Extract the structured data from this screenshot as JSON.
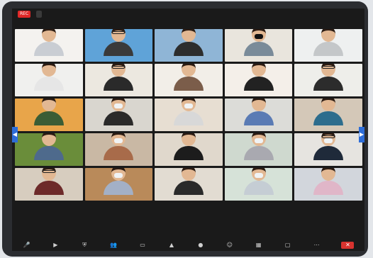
{
  "topbar": {
    "rec_label": "REC",
    "meeting_id": ""
  },
  "accent_colors": {
    "rec": "#e02828",
    "nav_arrow": "#2d6dd8",
    "end_button": "#d8332f"
  },
  "nav": {
    "prev_icon": "chevron-left-icon",
    "next_icon": "chevron-right-icon"
  },
  "tiles": [
    {
      "name": "",
      "bg": "#f4f2ef",
      "shirt": "#c9cdd3",
      "mask": "",
      "glasses": false
    },
    {
      "name": "",
      "bg": "#5fa3d8",
      "shirt": "#3a3a3a",
      "mask": "",
      "glasses": true
    },
    {
      "name": "",
      "bg": "#8fb5d6",
      "shirt": "#2d2d2d",
      "mask": "",
      "glasses": false
    },
    {
      "name": "",
      "bg": "#e9e5dd",
      "shirt": "#7a8b99",
      "mask": "black",
      "glasses": false
    },
    {
      "name": "",
      "bg": "#eef0f0",
      "shirt": "#c4c7c9",
      "mask": "",
      "glasses": false
    },
    {
      "name": "",
      "bg": "#f0f0ee",
      "shirt": "#e6e6e6",
      "mask": "",
      "glasses": false
    },
    {
      "name": "",
      "bg": "#ece8e0",
      "shirt": "#2a2a2a",
      "mask": "",
      "glasses": true
    },
    {
      "name": "",
      "bg": "#f2eee8",
      "shirt": "#7b5d4a",
      "mask": "",
      "glasses": false
    },
    {
      "name": "",
      "bg": "#f4efe9",
      "shirt": "#222222",
      "mask": "",
      "glasses": false
    },
    {
      "name": "",
      "bg": "#eeeeea",
      "shirt": "#2c2c2c",
      "mask": "",
      "glasses": true
    },
    {
      "name": "",
      "bg": "#e8a54a",
      "shirt": "#3b5d35",
      "mask": "",
      "glasses": false
    },
    {
      "name": "",
      "bg": "#d9d6cf",
      "shirt": "#2a2a2a",
      "mask": "white",
      "glasses": false
    },
    {
      "name": "",
      "bg": "#e7ded2",
      "shirt": "#d8d8d8",
      "mask": "white",
      "glasses": false
    },
    {
      "name": "",
      "bg": "#dcdcd8",
      "shirt": "#5a7bb4",
      "mask": "",
      "glasses": false
    },
    {
      "name": "",
      "bg": "#d4c8b8",
      "shirt": "#2d6d8d",
      "mask": "",
      "glasses": false
    },
    {
      "name": "",
      "bg": "#6a8d3a",
      "shirt": "#4e6a8c",
      "mask": "",
      "glasses": false
    },
    {
      "name": "",
      "bg": "#c9b8a4",
      "shirt": "#a86b4a",
      "mask": "white",
      "glasses": false
    },
    {
      "name": "",
      "bg": "#e0d8cc",
      "shirt": "#1c1c1c",
      "mask": "",
      "glasses": false
    },
    {
      "name": "",
      "bg": "#cfd9cf",
      "shirt": "#a9a9b0",
      "mask": "white",
      "glasses": false
    },
    {
      "name": "",
      "bg": "#e6e4e0",
      "shirt": "#1f2a3a",
      "mask": "white",
      "glasses": true
    },
    {
      "name": "",
      "bg": "#d7cdbf",
      "shirt": "#6d2a2a",
      "mask": "",
      "glasses": true
    },
    {
      "name": "",
      "bg": "#b98a5a",
      "shirt": "#a3b0c6",
      "mask": "white",
      "glasses": false
    },
    {
      "name": "",
      "bg": "#e2dcd2",
      "shirt": "#2a2a2a",
      "mask": "",
      "glasses": false
    },
    {
      "name": "",
      "bg": "#d6e2d8",
      "shirt": "#c5cdd4",
      "mask": "white",
      "glasses": false
    },
    {
      "name": "",
      "bg": "#d2d6dc",
      "shirt": "#e0b6c8",
      "mask": "",
      "glasses": false
    }
  ],
  "toolbar": [
    "mic-icon",
    "video-icon",
    "security-icon",
    "participants-icon",
    "chat-icon",
    "share-screen-icon",
    "record-icon",
    "reactions-icon",
    "apps-icon",
    "whiteboard-icon",
    "more-icon",
    "end-button"
  ]
}
